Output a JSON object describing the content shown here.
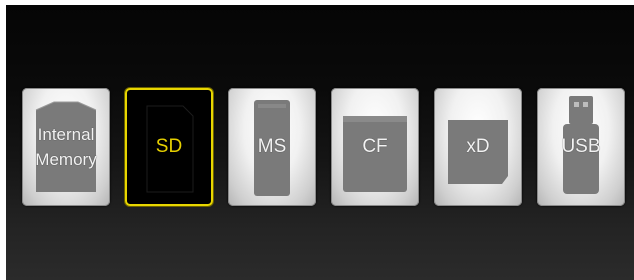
{
  "selected_index": 1,
  "colors": {
    "selection": "#e8d600",
    "tile_card": "#7a7a7a",
    "background_top": "#050505",
    "background_bottom": "#2b2b2b"
  },
  "storage_options": [
    {
      "label_line1": "Internal",
      "label_line2": "Memory",
      "icon": "internal-memory-icon"
    },
    {
      "label_line1": "SD",
      "icon": "sd-card-icon"
    },
    {
      "label_line1": "MS",
      "icon": "memory-stick-icon"
    },
    {
      "label_line1": "CF",
      "icon": "compact-flash-icon"
    },
    {
      "label_line1": "xD",
      "icon": "xd-card-icon"
    },
    {
      "label_line1": "USB",
      "icon": "usb-drive-icon"
    }
  ]
}
